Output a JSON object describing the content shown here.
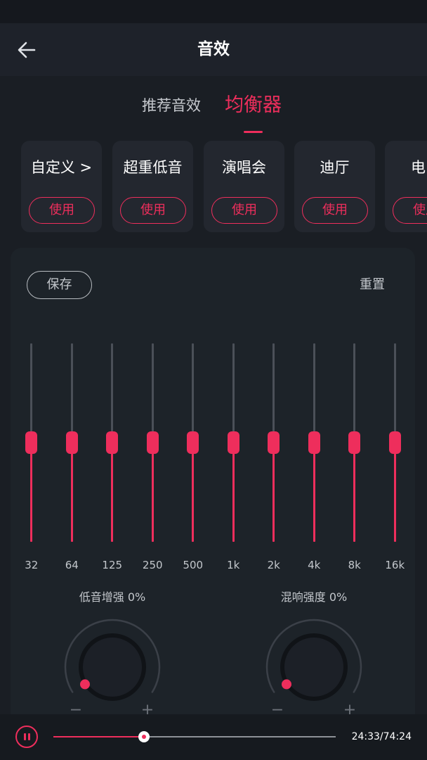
{
  "colors": {
    "accent": "#ee2e5c",
    "track_inactive": "#4b5058",
    "background": "#1a1e24"
  },
  "header": {
    "title": "音效",
    "back_icon": "arrow-left-icon"
  },
  "tabs": [
    {
      "label": "推荐音效",
      "active": false
    },
    {
      "label": "均衡器",
      "active": true
    }
  ],
  "presets": [
    {
      "label": "自定义 >",
      "button": "使用"
    },
    {
      "label": "超重低音",
      "button": "使用"
    },
    {
      "label": "演唱会",
      "button": "使用"
    },
    {
      "label": "迪厅",
      "button": "使用"
    },
    {
      "label": "电",
      "button": "使用"
    }
  ],
  "equalizer": {
    "save_label": "保存",
    "reset_label": "重置",
    "bands": [
      {
        "label": "32",
        "level": 0.5
      },
      {
        "label": "64",
        "level": 0.5
      },
      {
        "label": "125",
        "level": 0.5
      },
      {
        "label": "250",
        "level": 0.5
      },
      {
        "label": "500",
        "level": 0.5
      },
      {
        "label": "1k",
        "level": 0.5
      },
      {
        "label": "2k",
        "level": 0.5
      },
      {
        "label": "4k",
        "level": 0.5
      },
      {
        "label": "8k",
        "level": 0.5
      },
      {
        "label": "16k",
        "level": 0.5
      }
    ]
  },
  "knobs": [
    {
      "label": "低音增强 0%",
      "level": 0,
      "minus": "−",
      "plus": "+"
    },
    {
      "label": "混响强度 0%",
      "level": 0,
      "minus": "−",
      "plus": "+"
    }
  ],
  "player": {
    "pause_icon": "pause-icon",
    "progress": 0.32,
    "time": "24:33/74:24"
  }
}
